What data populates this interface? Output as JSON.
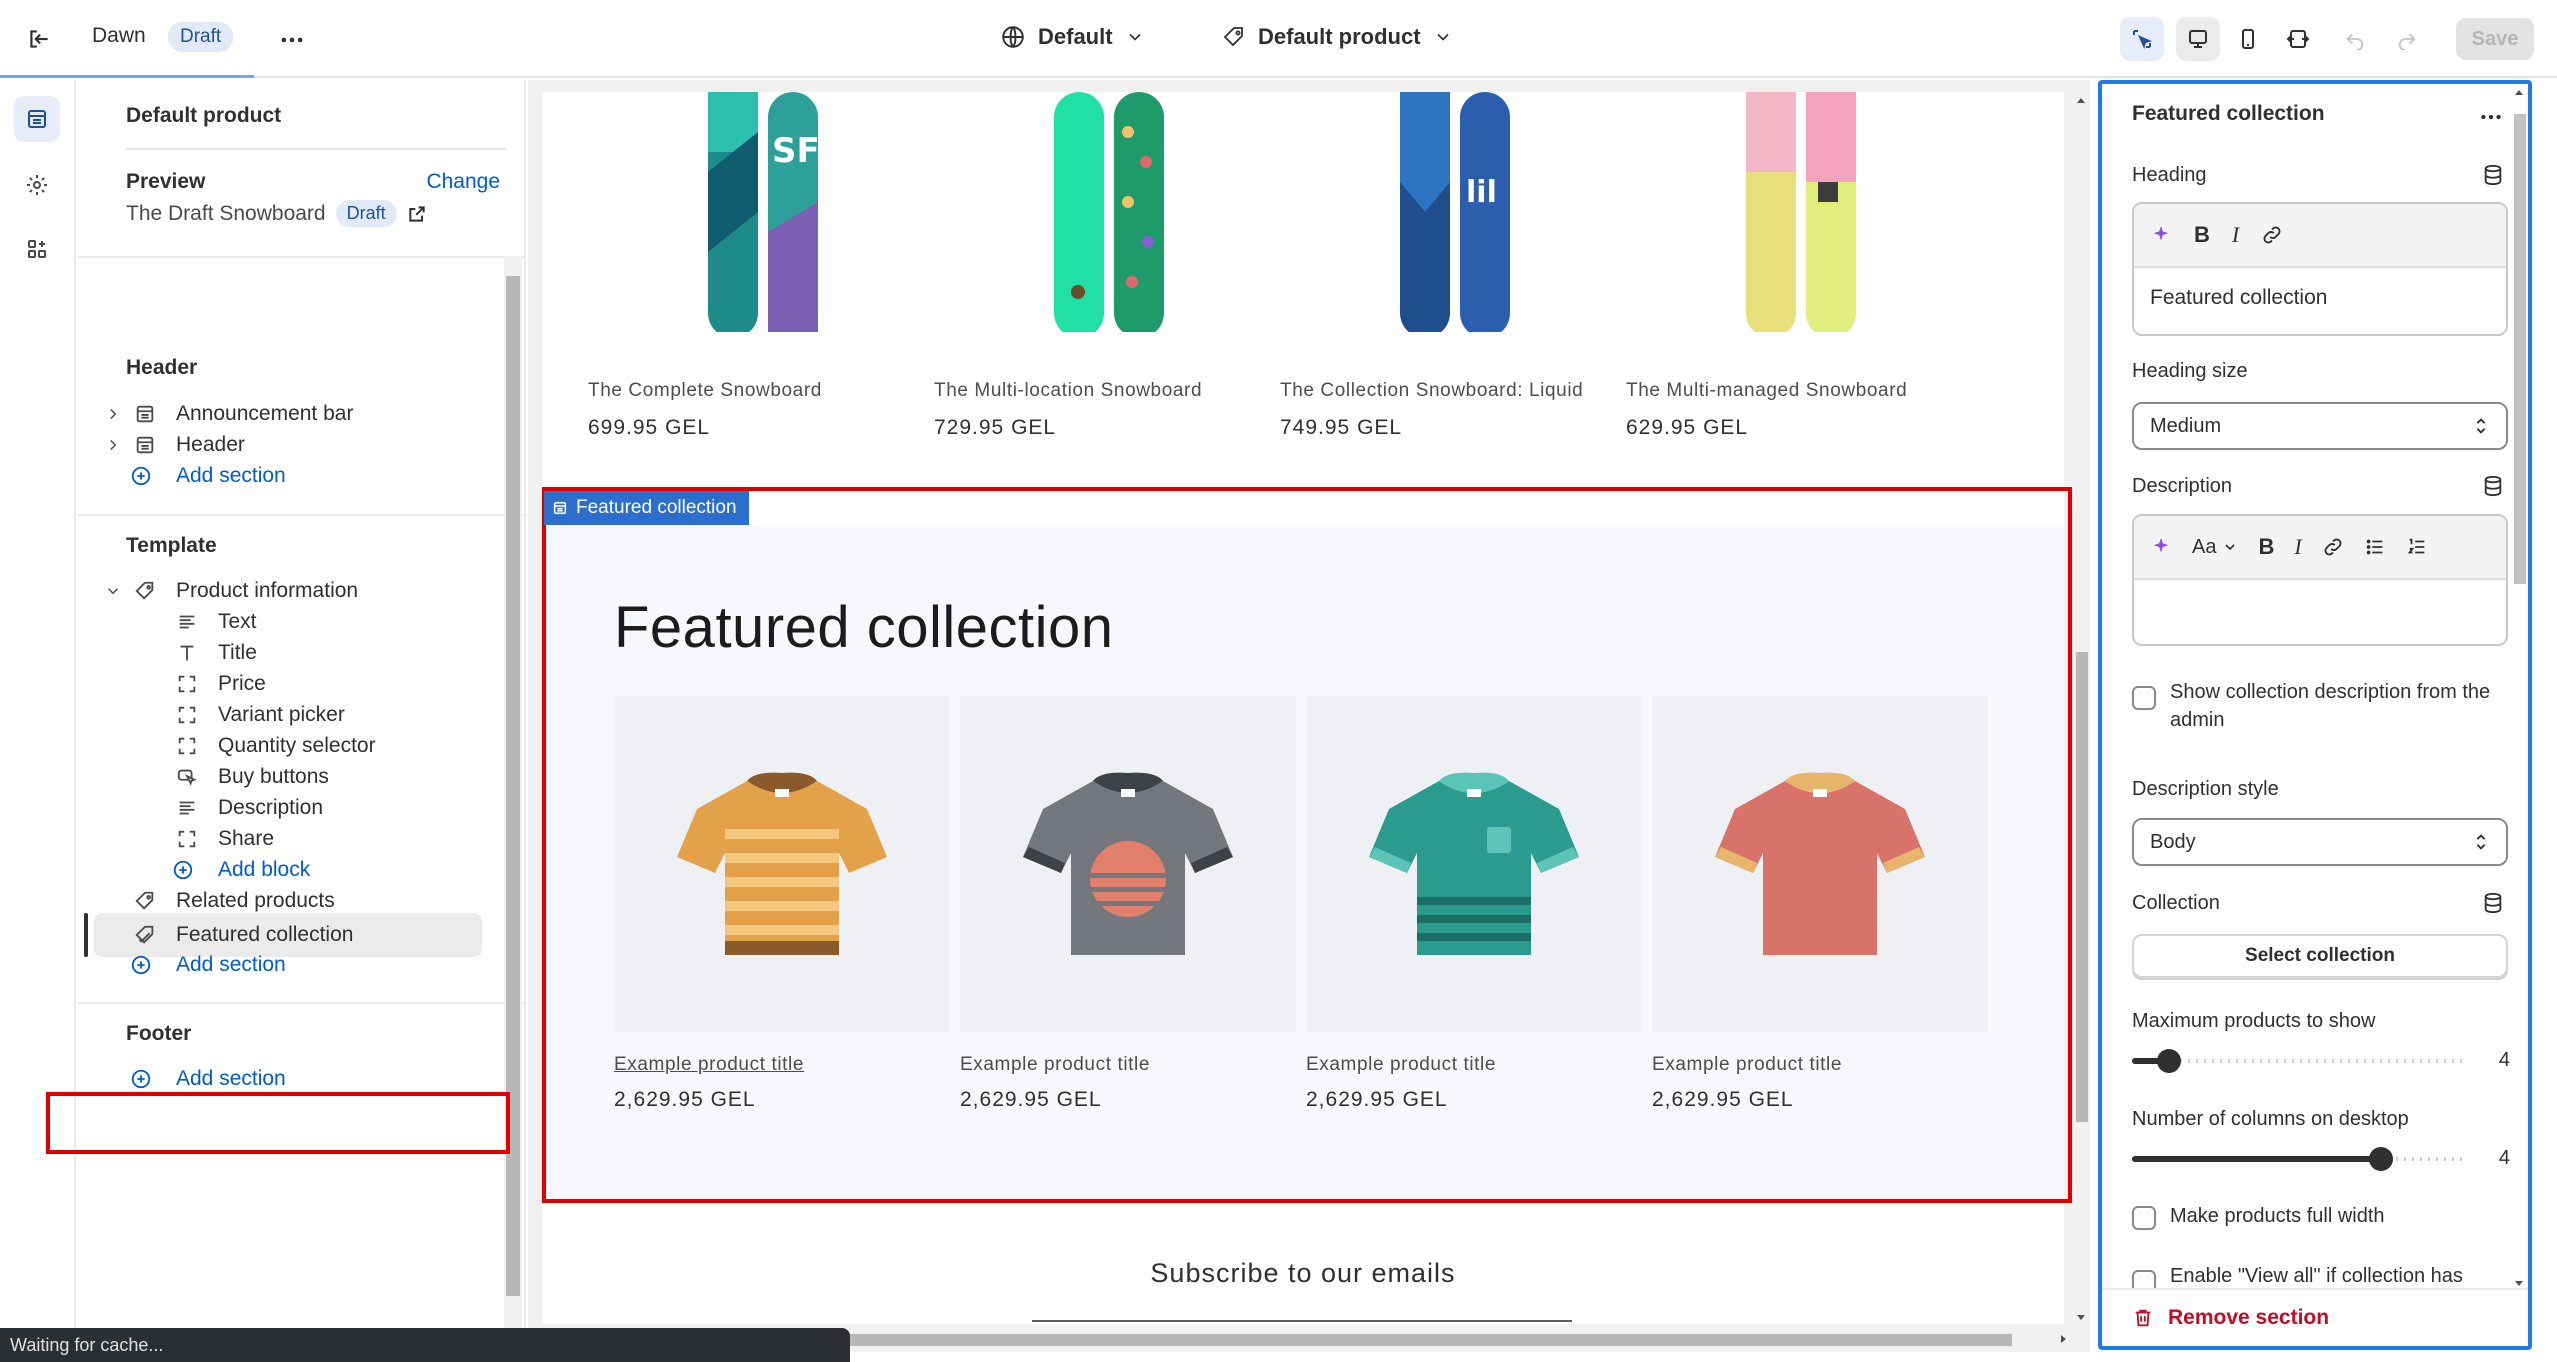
{
  "topbar": {
    "theme_name": "Dawn",
    "theme_badge": "Draft",
    "locale_select": "Default",
    "template_select": "Default product",
    "save_label": "Save"
  },
  "left_panel": {
    "title": "Default product",
    "preview_label": "Preview",
    "change_label": "Change",
    "preview_value": "The Draft Snowboard",
    "preview_badge": "Draft",
    "groups": {
      "header": "Header",
      "template": "Template",
      "footer": "Footer"
    },
    "header_items": [
      "Announcement bar",
      "Header"
    ],
    "add_section": "Add section",
    "template_items": {
      "product_information": "Product information",
      "blocks": [
        "Text",
        "Title",
        "Price",
        "Variant picker",
        "Quantity selector",
        "Buy buttons",
        "Description",
        "Share"
      ],
      "add_block": "Add block",
      "related_products": "Related products",
      "featured_collection": "Featured collection"
    }
  },
  "canvas": {
    "products": [
      {
        "name": "The Complete Snowboard",
        "price": "699.95 GEL"
      },
      {
        "name": "The Multi-location Snowboard",
        "price": "729.95 GEL"
      },
      {
        "name": "The Collection Snowboard: Liquid",
        "price": "749.95 GEL"
      },
      {
        "name": "The Multi-managed Snowboard",
        "price": "629.95 GEL"
      }
    ],
    "section_tag": "Featured collection",
    "featured_heading": "Featured collection",
    "featured_products": [
      {
        "name": "Example product title",
        "price": "2,629.95 GEL"
      },
      {
        "name": "Example product title",
        "price": "2,629.95 GEL"
      },
      {
        "name": "Example product title",
        "price": "2,629.95 GEL"
      },
      {
        "name": "Example product title",
        "price": "2,629.95 GEL"
      }
    ],
    "subscribe_title": "Subscribe to our emails"
  },
  "status_text": "Waiting for cache...",
  "right_panel": {
    "title": "Featured collection",
    "heading_label": "Heading",
    "heading_value": "Featured collection",
    "heading_size_label": "Heading size",
    "heading_size_value": "Medium",
    "description_label": "Description",
    "description_font_label": "Aa",
    "show_description_label": "Show collection description from the admin",
    "description_style_label": "Description style",
    "description_style_value": "Body",
    "collection_label": "Collection",
    "select_collection_label": "Select collection",
    "max_products_label": "Maximum products to show",
    "max_products_value": "4",
    "max_products_fraction": 0.11,
    "columns_label": "Number of columns on desktop",
    "columns_value": "4",
    "columns_fraction": 0.74,
    "full_width_label": "Make products full width",
    "view_all_label": "Enable \"View all\" if collection has",
    "remove_label": "Remove section"
  },
  "colors": {
    "accent_blue": "#005bd3",
    "selection_blue": "#1f7be8",
    "highlight_red": "#e00000",
    "danger": "#c70a24"
  }
}
